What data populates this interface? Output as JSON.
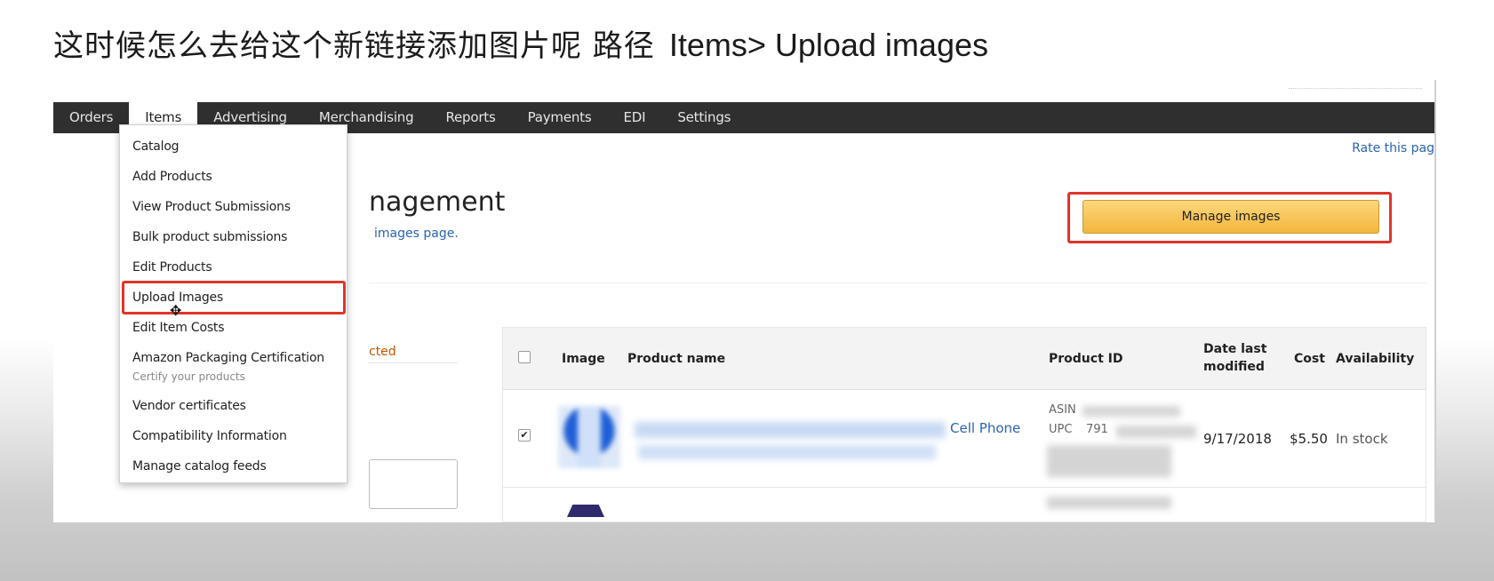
{
  "caption": {
    "cjk": "这时候怎么去给这个新链接添加图片呢  路径",
    "path": "Items> Upload images"
  },
  "nav": {
    "items": [
      "Orders",
      "Items",
      "Advertising",
      "Merchandising",
      "Reports",
      "Payments",
      "EDI",
      "Settings"
    ],
    "active": "Items"
  },
  "header": {
    "rate_link": "Rate this pag",
    "title": "nagement",
    "subtitle": "images page."
  },
  "manage_button": {
    "label": "Manage images"
  },
  "side": {
    "link": "cted"
  },
  "dropdown": {
    "items": [
      "Catalog",
      "Add Products",
      "View Product Submissions",
      "Bulk product submissions",
      "Edit Products",
      "Upload Images",
      "Edit Item Costs",
      "Amazon Packaging Certification",
      "Vendor certificates",
      "Compatibility Information",
      "Manage catalog feeds"
    ],
    "sub_label": "Certify your products",
    "highlighted": "Upload Images"
  },
  "table": {
    "headers": {
      "image": "Image",
      "product_name": "Product name",
      "product_id": "Product ID",
      "date_last": "Date last",
      "modified": "modified",
      "cost": "Cost",
      "availability": "Availability"
    },
    "row1": {
      "checked": true,
      "name_visible": "Cell Phone",
      "asin_label": "ASIN",
      "upc_label": "UPC",
      "upc_partial": "791",
      "date": "9/17/2018",
      "cost": "$5.50",
      "availability": "In stock"
    }
  },
  "colors": {
    "navbar": "#2f2f2f",
    "highlight_border": "#e0352a",
    "button": "#f4b63d",
    "link": "#2a63b0"
  },
  "icons": {
    "checkbox_checked": "✔",
    "cursor": "✥"
  }
}
